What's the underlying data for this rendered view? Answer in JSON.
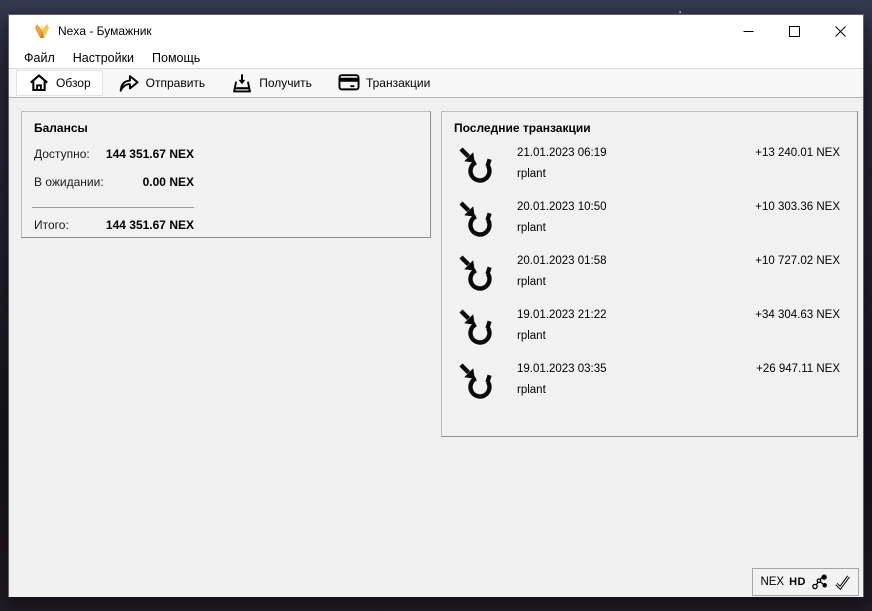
{
  "window": {
    "title": "Nexa - Бумажник"
  },
  "menu": {
    "items": [
      "Файл",
      "Настройки",
      "Помощь"
    ]
  },
  "toolbar": {
    "items": [
      {
        "label": "Обзор",
        "icon": "home-icon",
        "active": true
      },
      {
        "label": "Отправить",
        "icon": "send-arrow-icon",
        "active": false
      },
      {
        "label": "Получить",
        "icon": "receive-tray-icon",
        "active": false
      },
      {
        "label": "Транзакции",
        "icon": "credit-card-icon",
        "active": false
      }
    ]
  },
  "balances": {
    "title": "Балансы",
    "rows": [
      {
        "label": "Доступно:",
        "value": "144 351.67 NEX"
      },
      {
        "label": "В ожидании:",
        "value": "0.00 NEX"
      },
      {
        "label": "Итого:",
        "value": "144 351.67 NEX"
      }
    ]
  },
  "transactions": {
    "title": "Последние транзакции",
    "items": [
      {
        "date": "21.01.2023 06:19",
        "label": "rplant",
        "amount": "+13 240.01 NEX"
      },
      {
        "date": "20.01.2023 10:50",
        "label": "rplant",
        "amount": "+10 303.36 NEX"
      },
      {
        "date": "20.01.2023 01:58",
        "label": "rplant",
        "amount": "+10 727.02 NEX"
      },
      {
        "date": "19.01.2023 21:22",
        "label": "rplant",
        "amount": "+34 304.63 NEX"
      },
      {
        "date": "19.01.2023 03:35",
        "label": "rplant",
        "amount": "+26 947.11 NEX"
      }
    ]
  },
  "statusbar": {
    "unit": "NEX",
    "hd_badge": "HD"
  },
  "colors": {
    "accent_gold": "#f2b705",
    "window_bg": "#f0f0f0",
    "titlebar_bg": "#ffffff"
  }
}
